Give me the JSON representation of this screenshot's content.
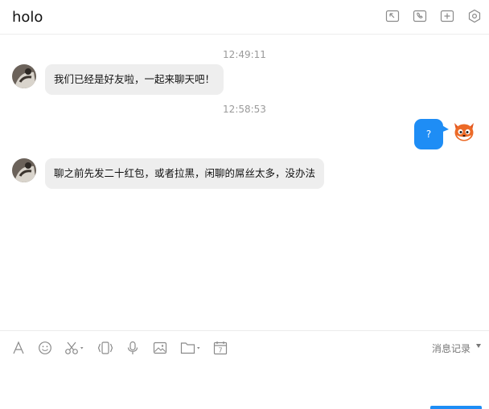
{
  "chat": {
    "title": "holo",
    "header_icons": [
      "exit-fullscreen-icon",
      "phone-icon",
      "add-icon",
      "settings-icon"
    ]
  },
  "messages": [
    {
      "time": "12:49:11"
    },
    {
      "side": "in",
      "text": "我们已经是好友啦，一起来聊天吧！",
      "avatar": "user-photo-avatar"
    },
    {
      "time": "12:58:53"
    },
    {
      "side": "out",
      "text": "?",
      "avatar": "fox-avatar"
    },
    {
      "side": "in",
      "text": "聊之前先发二十红包，或者拉黑，闲聊的屌丝太多，没办法",
      "avatar": "user-photo-avatar"
    }
  ],
  "toolbar": {
    "icons": [
      "font-icon",
      "emoji-icon",
      "scissors-icon",
      "shake-icon",
      "microphone-icon",
      "image-icon",
      "folder-icon",
      "calendar-icon"
    ],
    "calendar_day": "7",
    "history_label": "消息记录"
  },
  "colors": {
    "accent": "#1e8df5",
    "incoming_bubble": "#eeeeee",
    "timestamp": "#9a9a9a"
  }
}
